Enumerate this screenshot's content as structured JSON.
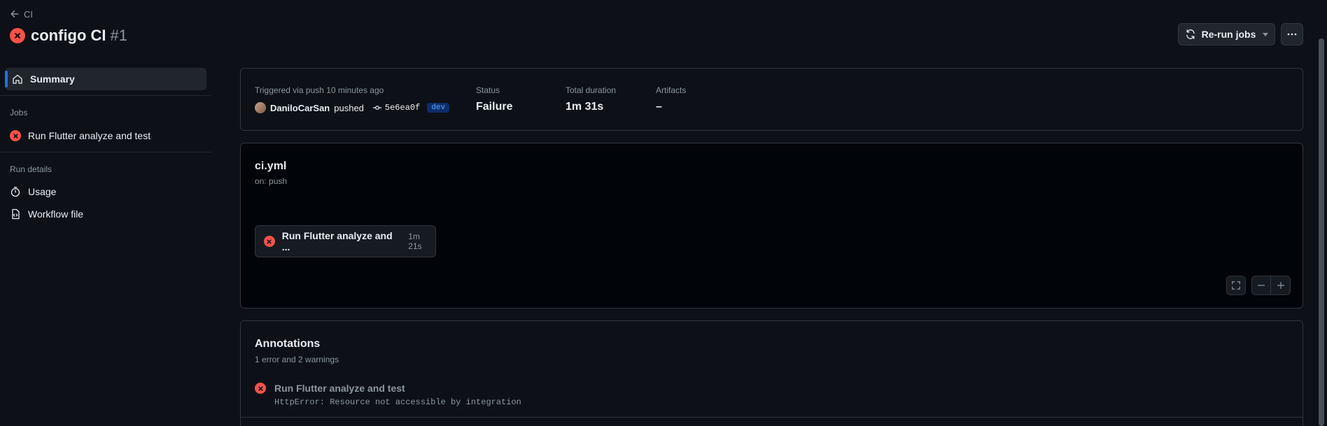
{
  "header": {
    "back_label": "CI",
    "title": "configo CI",
    "run_number": "#1",
    "rerun_label": "Re-run jobs"
  },
  "sidebar": {
    "summary_label": "Summary",
    "jobs_heading": "Jobs",
    "jobs": [
      {
        "label": "Run Flutter analyze and test",
        "status": "failure"
      }
    ],
    "run_details_heading": "Run details",
    "details": [
      {
        "label": "Usage",
        "icon": "stopwatch-icon"
      },
      {
        "label": "Workflow file",
        "icon": "file-code-icon"
      }
    ]
  },
  "summary": {
    "trigger_text": "Triggered via push 10 minutes ago",
    "actor": "DaniloCarSan",
    "action": "pushed",
    "commit": "5e6ea0f",
    "branch": "dev",
    "status_label": "Status",
    "status_value": "Failure",
    "duration_label": "Total duration",
    "duration_value": "1m 31s",
    "artifacts_label": "Artifacts",
    "artifacts_value": "–"
  },
  "workflow": {
    "file": "ci.yml",
    "trigger": "on: push",
    "job_name": "Run Flutter analyze and ...",
    "job_duration": "1m 21s"
  },
  "annotations": {
    "title": "Annotations",
    "subtitle": "1 error and 2 warnings",
    "items": [
      {
        "job": "Run Flutter analyze and test",
        "message": "HttpError: Resource not accessible by integration",
        "level": "error"
      }
    ]
  },
  "colors": {
    "background": "#0d1117",
    "error": "#f85149",
    "accent": "#1f6feb",
    "branch_bg": "#0c2d6b",
    "branch_fg": "#58a6ff"
  }
}
